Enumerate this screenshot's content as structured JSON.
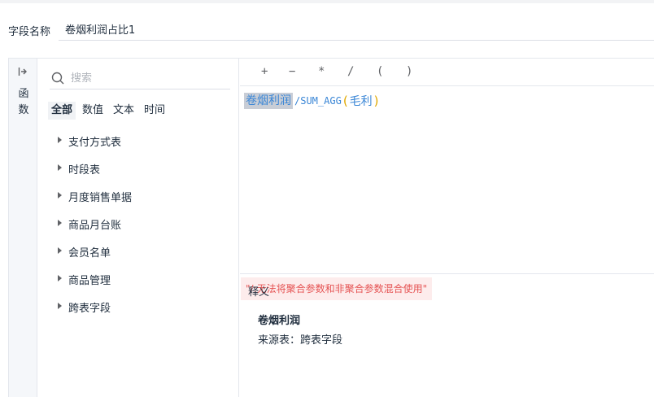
{
  "field": {
    "label": "字段名称",
    "value": "卷烟利润占比1"
  },
  "side_tab": {
    "label": "函数",
    "icon": "collapse-arrow-icon"
  },
  "search": {
    "placeholder": "搜索",
    "icon": "search-icon"
  },
  "filters": [
    {
      "label": "全部",
      "active": true
    },
    {
      "label": "数值",
      "active": false
    },
    {
      "label": "文本",
      "active": false
    },
    {
      "label": "时间",
      "active": false
    }
  ],
  "tables": [
    {
      "label": "支付方式表"
    },
    {
      "label": "时段表"
    },
    {
      "label": "月度销售单据"
    },
    {
      "label": "商品月台账"
    },
    {
      "label": "会员名单"
    },
    {
      "label": "商品管理"
    },
    {
      "label": "跨表字段"
    }
  ],
  "operators": [
    "+",
    "−",
    "*",
    "/",
    "(",
    ")"
  ],
  "formula": {
    "field_token": "卷烟利润",
    "operator": "/",
    "function": "SUM_AGG",
    "open_paren": "(",
    "argument": "毛利",
    "close_paren": ")"
  },
  "error": {
    "message": "\"/:无法将聚合参数和非聚合参数混合使用\""
  },
  "description": {
    "title": "释义",
    "name": "卷烟利润",
    "source": "来源表：跨表字段"
  },
  "colors": {
    "token_blue": "#3a86d6",
    "paren_yellow": "#e0a800",
    "error_red": "#e55353",
    "error_bg": "#fdecec"
  }
}
